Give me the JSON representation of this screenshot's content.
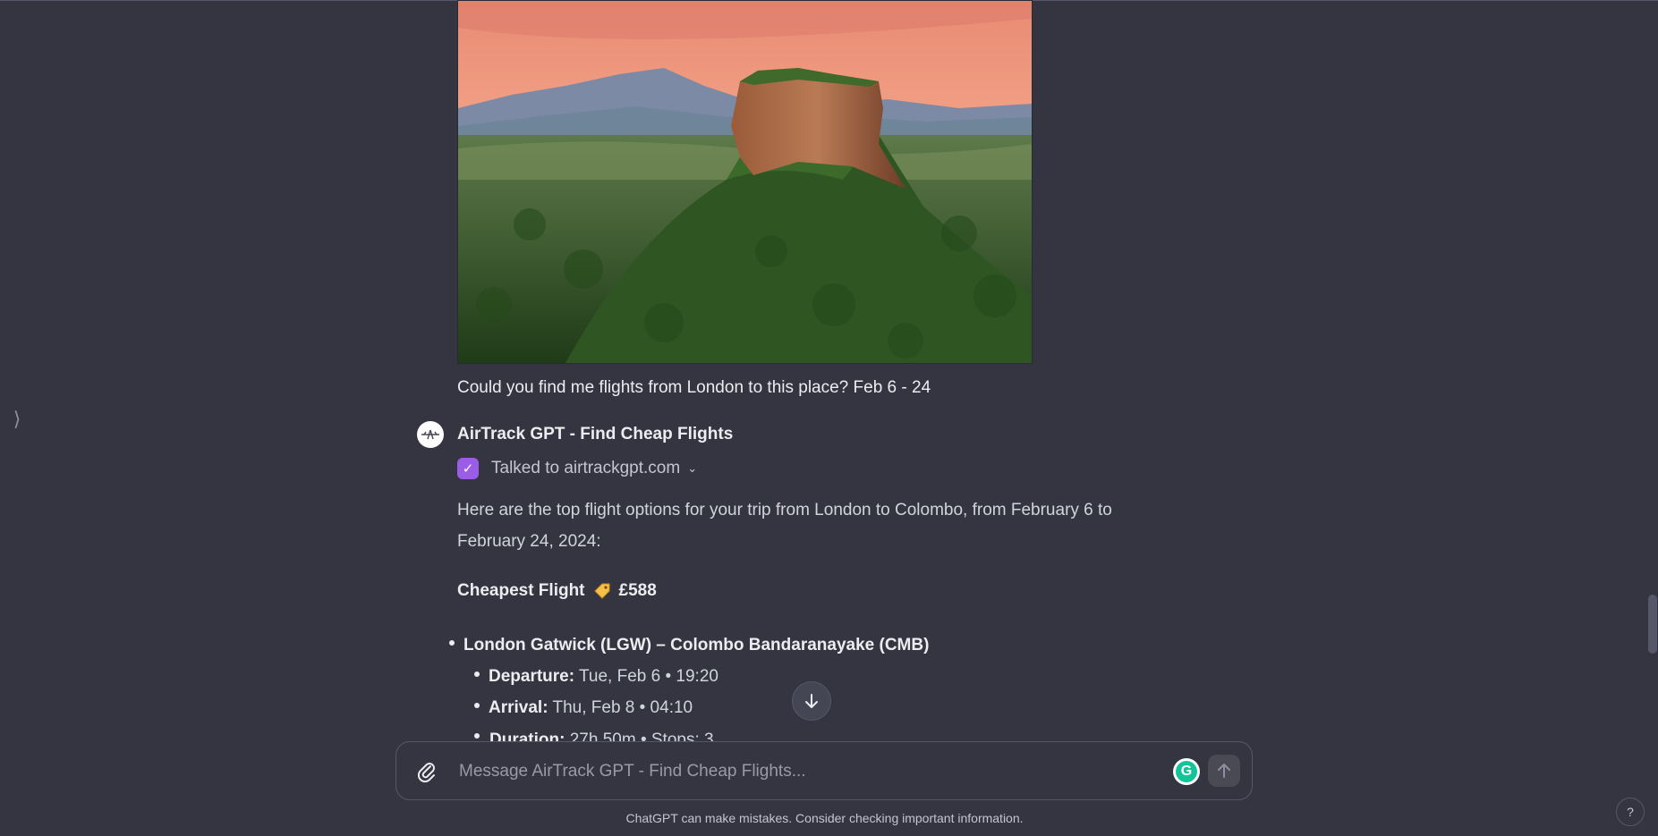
{
  "sidebar": {
    "toggle_icon": "chevron-right-icon"
  },
  "conversation": {
    "user_message": "Could you find me flights from London to this place? Feb 6 - 24",
    "assistant": {
      "name": "AirTrack GPT - Find Cheap Flights",
      "tool_status": "Talked to airtrackgpt.com",
      "intro": "Here are the top flight options for your trip from London to Colombo, from February 6 to February 24, 2024:",
      "cheapest_heading": "Cheapest Flight",
      "cheapest_price": "£588",
      "route": "London Gatwick (LGW) – Colombo Bandaranayake (CMB)",
      "details": [
        {
          "label": "Departure:",
          "value": "Tue, Feb 6 • 19:20"
        },
        {
          "label": "Arrival:",
          "value": "Thu, Feb 8 • 04:10"
        },
        {
          "label": "Duration:",
          "value": "27h 50m • Stops: 3"
        }
      ]
    }
  },
  "composer": {
    "placeholder": "Message AirTrack GPT - Find Cheap Flights...",
    "attach_icon": "paperclip-icon",
    "send_icon": "arrow-up-icon",
    "grammarly_letter": "G"
  },
  "footer": {
    "note": "ChatGPT can make mistakes. Consider checking important information."
  },
  "help_label": "?",
  "colors": {
    "background": "#343541",
    "check_badge": "#9b5de5",
    "text": "#ececf1"
  }
}
